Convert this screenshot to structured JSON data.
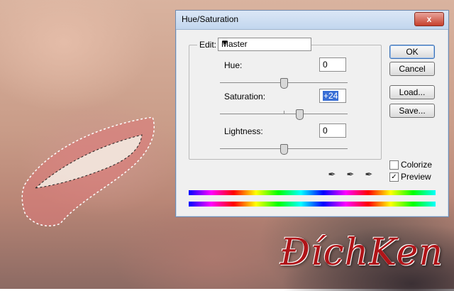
{
  "window": {
    "title": "Hue/Saturation",
    "close_glyph": "x"
  },
  "edit": {
    "label": "Edit:",
    "selected": "Master"
  },
  "sliders": [
    {
      "label": "Hue:",
      "value": "0",
      "position": 0.5
    },
    {
      "label": "Saturation:",
      "value": "+24",
      "position": 0.62
    },
    {
      "label": "Lightness:",
      "value": "0",
      "position": 0.5
    }
  ],
  "buttons": {
    "ok": "OK",
    "cancel": "Cancel",
    "load": "Load...",
    "save": "Save..."
  },
  "options": {
    "colorize_label": "Colorize",
    "colorize_checked": false,
    "preview_label": "Preview",
    "preview_checked": true
  },
  "watermark": {
    "text": "ĐíchKen"
  },
  "icons": [
    "eyedropper-icon",
    "eyedropper-plus-icon",
    "eyedropper-minus-icon"
  ],
  "colors": {
    "selection": "#3a6fd6",
    "watermark": "#b01418"
  }
}
